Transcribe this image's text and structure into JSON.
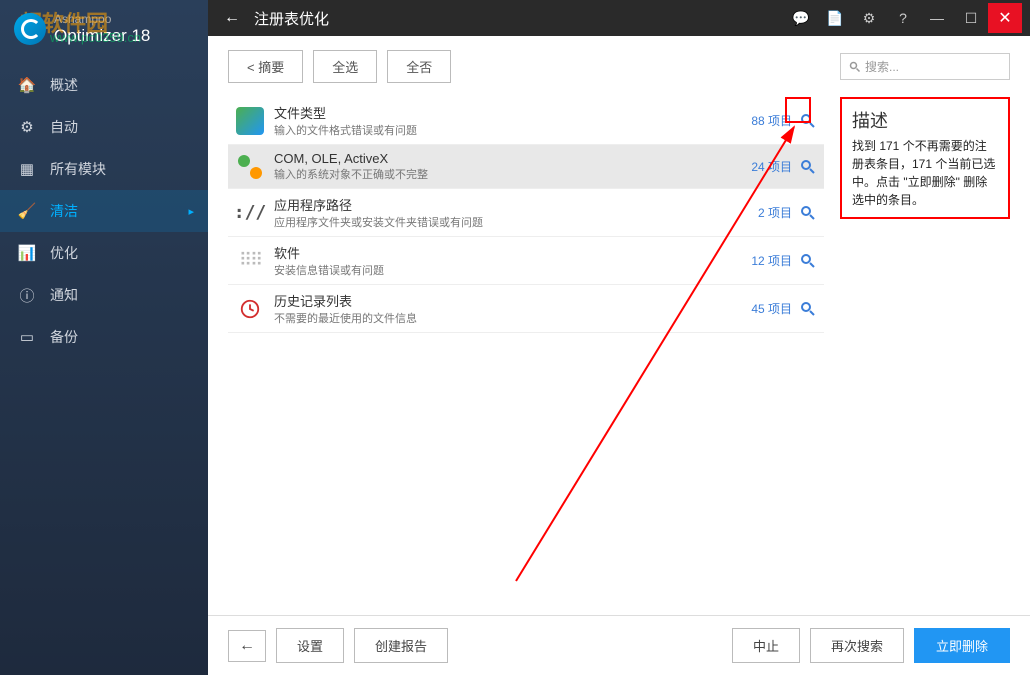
{
  "brand": {
    "company": "Ashampoo",
    "product": "Optimizer 18"
  },
  "watermark": {
    "line1": "超软件园",
    "line2": "www.pc0359.cn"
  },
  "nav": [
    {
      "icon": "home",
      "label": "概述"
    },
    {
      "icon": "auto",
      "label": "自动"
    },
    {
      "icon": "modules",
      "label": "所有模块"
    },
    {
      "icon": "clean",
      "label": "清洁",
      "active": true
    },
    {
      "icon": "optimize",
      "label": "优化"
    },
    {
      "icon": "notify",
      "label": "通知"
    },
    {
      "icon": "backup",
      "label": "备份"
    }
  ],
  "titlebar": {
    "back": "←",
    "title": "注册表优化"
  },
  "winButtons": [
    "chat-icon",
    "note-icon",
    "gear-icon",
    "help-icon",
    "minimize-icon",
    "maximize-icon",
    "close-icon"
  ],
  "toolbar": {
    "summary": "< 摘要",
    "selectAll": "全选",
    "selectNone": "全否"
  },
  "search": {
    "placeholder": "搜索..."
  },
  "list": [
    {
      "title": "文件类型",
      "desc": "输入的文件格式错误或有问题",
      "count": "88 项目"
    },
    {
      "title": "COM, OLE, ActiveX",
      "desc": "输入的系统对象不正确或不完整",
      "count": "24 项目",
      "selected": true
    },
    {
      "title": "应用程序路径",
      "desc": "应用程序文件夹或安装文件夹错误或有问题",
      "count": "2 项目"
    },
    {
      "title": "软件",
      "desc": "安装信息错误或有问题",
      "count": "12 项目"
    },
    {
      "title": "历史记录列表",
      "desc": "不需要的最近使用的文件信息",
      "count": "45 项目"
    }
  ],
  "description": {
    "title": "描述",
    "body": "找到 171 个不再需要的注册表条目，171 个当前已选中。点击 \"立即删除\" 删除选中的条目。"
  },
  "footer": {
    "back": "←",
    "settings": "设置",
    "report": "创建报告",
    "stop": "中止",
    "rescan": "再次搜索",
    "delete": "立即删除"
  }
}
